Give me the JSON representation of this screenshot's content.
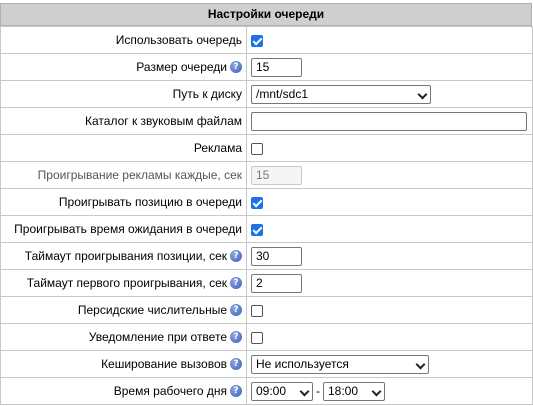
{
  "header": {
    "title": "Настройки очереди"
  },
  "rows": {
    "use_queue": {
      "label": "Использовать очередь",
      "checked": true
    },
    "queue_size": {
      "label": "Размер очереди",
      "value": "15"
    },
    "disk_path": {
      "label": "Путь к диску",
      "value": "/mnt/sdc1"
    },
    "sound_dir": {
      "label": "Каталог к звуковым файлам",
      "value": ""
    },
    "ads": {
      "label": "Реклама",
      "checked": false
    },
    "ads_interval": {
      "label": "Проигрывание рекламы каждые, сек",
      "value": "15"
    },
    "play_position": {
      "label": "Проигрывать позицию в очереди",
      "checked": true
    },
    "play_wait_time": {
      "label": "Проигрывать время ожидания в очереди",
      "checked": true
    },
    "position_timeout": {
      "label": "Таймаут проигрывания позиции, сек",
      "value": "30"
    },
    "first_play_timeout": {
      "label": "Таймаут первого проигрывания, сек",
      "value": "2"
    },
    "persian_numerals": {
      "label": "Персидские числительные",
      "checked": false
    },
    "answer_notify": {
      "label": "Уведомление при ответе",
      "checked": false
    },
    "call_caching": {
      "label": "Кеширование вызовов",
      "value": "Не используется"
    },
    "work_time": {
      "label": "Время рабочего дня",
      "from": "09:00",
      "separator": "-",
      "to": "18:00"
    }
  },
  "icons": {
    "help": "help-icon",
    "checkbox_checked": "checkbox-checked",
    "dropdown": "chevron-down-icon"
  },
  "colors": {
    "header_bg": "#cfcfcf",
    "check_accent": "#1a73e8",
    "help_icon": "#3c5fb8"
  }
}
